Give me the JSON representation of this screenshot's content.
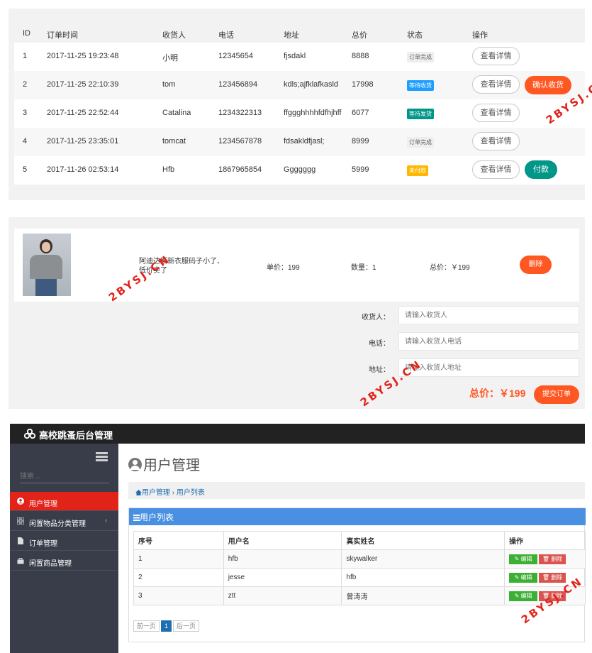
{
  "orders": {
    "headers": [
      "ID",
      "订单时间",
      "收货人",
      "电话",
      "地址",
      "总价",
      "状态",
      "操作"
    ],
    "rows": [
      {
        "id": "1",
        "time": "2017-11-25 19:23:48",
        "name": "小明",
        "phone": "12345654",
        "address": "fjsdakl",
        "total": "8888",
        "status": "订单完成",
        "status_color": "#eeeeee",
        "actions": [
          "查看详情"
        ]
      },
      {
        "id": "2",
        "time": "2017-11-25 22:10:39",
        "name": "tom",
        "phone": "123456894",
        "address": "kdls;ajfklafkasld",
        "total": "17998",
        "status": "等待收货",
        "status_color": "#1e9fff",
        "actions": [
          "查看详情",
          "确认收货"
        ]
      },
      {
        "id": "3",
        "time": "2017-11-25 22:52:44",
        "name": "Catalina",
        "phone": "1234322313",
        "address": "ffggghhhhfdfhjhff",
        "total": "6077",
        "status": "等待发货",
        "status_color": "#009688",
        "actions": [
          "查看详情"
        ]
      },
      {
        "id": "4",
        "time": "2017-11-25 23:35:01",
        "name": "tomcat",
        "phone": "1234567878",
        "address": "fdsakldfjasl;",
        "total": "8999",
        "status": "订单完成",
        "status_color": "#eeeeee",
        "actions": [
          "查看详情"
        ]
      },
      {
        "id": "5",
        "time": "2017-11-26 02:53:14",
        "name": "Hfb",
        "phone": "1867965854",
        "address": "Ggggggg",
        "total": "5999",
        "status": "未付款",
        "status_color": "#ffb800",
        "actions": [
          "查看详情",
          "付款"
        ]
      }
    ]
  },
  "cart": {
    "item": {
      "desc": "阿迪达斯新衣服码子小了、低价卖了",
      "price": "单价：199",
      "qty": "数量：1",
      "total": "总价：￥199",
      "delete_label": "删除"
    },
    "form": {
      "receiver_label": "收货人：",
      "receiver_placeholder": "请输入收货人",
      "phone_label": "电话：",
      "phone_placeholder": "请输入收货人电话",
      "address_label": "地址：",
      "address_placeholder": "请输入收货人地址"
    },
    "grand_total": "总价：￥199",
    "submit_label": "提交订单"
  },
  "admin": {
    "brand": "高校跳蚤后台管理",
    "search_placeholder": "搜索...",
    "menu": [
      {
        "label": "用户管理",
        "icon": "user-circle-icon",
        "active": true
      },
      {
        "label": "闲置物品分类管理",
        "icon": "category-icon",
        "caret": "‹"
      },
      {
        "label": "订单管理",
        "icon": "file-icon"
      },
      {
        "label": "闲置商品管理",
        "icon": "bag-icon"
      }
    ],
    "page_title": "用户管理",
    "breadcrumb": "用户管理 › 用户列表",
    "list_title": "用户列表",
    "table": {
      "headers": [
        "序号",
        "用户名",
        "真实姓名",
        "操作"
      ],
      "rows": [
        {
          "no": "1",
          "username": "hfb",
          "realname": "skywalker"
        },
        {
          "no": "2",
          "username": "jesse",
          "realname": "hfb"
        },
        {
          "no": "3",
          "username": "ztt",
          "realname": "曾涛涛"
        }
      ],
      "edit_label": "编辑",
      "delete_label": "删除"
    },
    "pager": {
      "prev": "前一页",
      "current": "1",
      "next": "后一页"
    }
  },
  "watermark": "2BYSJ.CN"
}
